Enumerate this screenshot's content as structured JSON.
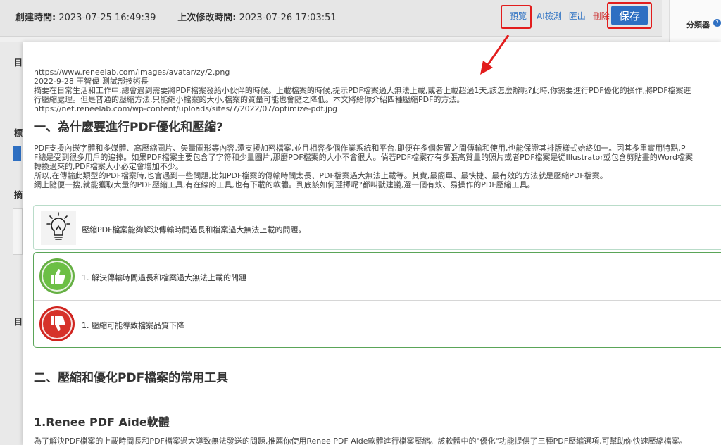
{
  "editor": {
    "created_label": "創建時間:",
    "created_value": "2023-07-25 16:49:39",
    "modified_label": "上次修改時間:",
    "modified_value": "2023-07-26 17:03:51"
  },
  "toolbar": {
    "preview": "預覽",
    "ai_detect": "AI檢測",
    "export": "匯出",
    "delete": "刪除",
    "save": "保存"
  },
  "right_panel": {
    "category_label": "分類器",
    "help": "?"
  },
  "left_strip": {
    "t1": "目",
    "t2": "標",
    "t3": "摘",
    "t4": "目"
  },
  "preview": {
    "lines": [
      "https://www.reneelab.com/images/avatar/zy/2.png",
      "2022-9-28 王智偉 測試部技術長",
      "摘要在日常生活和工作中,總會遇到需要將PDF檔案發給小伙伴的時候。上載檔案的時候,提示PDF檔案過大無法上載,或者上載超過1天,該怎麼辦呢?此時,你需要進行PDF優化的操作,將PDF檔案進",
      "行壓縮處理。但是普通的壓縮方法,只能縮小檔案的大小,檔案的質量可能也會隨之降低。本文將給你介紹四種壓縮PDF的方法。",
      "https://net.reneelab.com/wp-content/uploads/sites/7/2022/07/optimize-pdf.jpg"
    ],
    "heading1": "一、為什麼要進行PDF優化和壓縮?",
    "para_lines": [
      "PDF支援內嵌字體和多媒體、高壓縮圖片、矢量圖形等內容,還支援加密檔案,並且相容多個作業系統和平台,即便在多個裝置之間傳輸和使用,也能保證其排版樣式始終如一。因其多重實用特點,P",
      "F總是受到很多用戶的追捧。如果PDF檔案主要包含了字符和少量圖片,那麼PDF檔案的大小不會很大。倘若PDF檔案存有多張高質量的照片或者PDF檔案是從Illustrator或包含剪貼畫的Word檔案",
      "轉換過來的,PDF檔案大小必定會增加不少。",
      "所以,在傳輸此類型的PDF檔案時,也會遇到一些問題,比如PDF檔案的傳輸時間太長、PDF檔案過大無法上載等。其實,最簡單、最快捷、最有效的方法就是壓縮PDF檔案。",
      "網上隨便一搜,就能獲取大量的PDF壓縮工具,有在線的工具,也有下載的軟體。到底該如何選擇呢?都叫獸建議,選一個有效、易操作的PDF壓縮工具。"
    ],
    "tip": "壓縮PDF檔案能夠解決傳輸時間過長和檔案過大無法上載的問題。",
    "pro": "1. 解決傳輸時間過長和檔案過大無法上載的問題",
    "con": "1. 壓縮可能導致檔案品質下降",
    "heading2": "二、壓縮和優化PDF檔案的常用工具",
    "heading3": "1.Renee PDF Aide軟體",
    "last_line": "為了解決PDF檔案的上載時間長和PDF檔案過大導致無法發送的問題,推薦你使用Renee PDF Aide軟體進行檔案壓縮。該軟體中的\"優化\"功能提供了三種PDF壓縮選項,可幫助你快速壓縮檔案。"
  },
  "colors": {
    "accent": "#2e6fc2",
    "highlight": "#e21d1d",
    "pro": "#66b044",
    "con": "#d0241f"
  }
}
